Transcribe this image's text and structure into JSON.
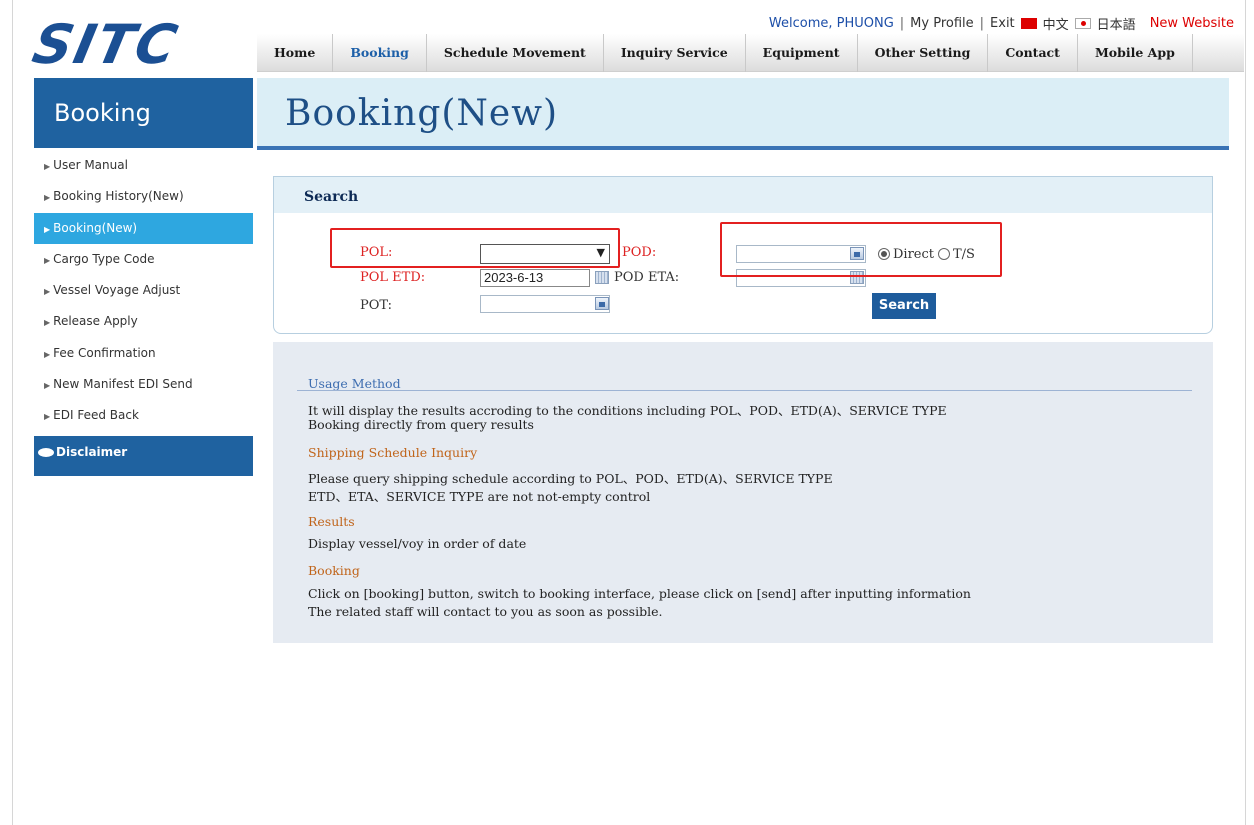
{
  "header": {
    "logo": "SITC",
    "welcome": "Welcome, PHUONG",
    "sep": "|",
    "my_profile": "My Profile",
    "exit": "Exit",
    "lang_cn": "中文",
    "lang_jp": "日本語",
    "new_website": "New Website"
  },
  "nav": [
    "Home",
    "Booking",
    "Schedule Movement",
    "Inquiry Service",
    "Equipment",
    "Other Setting",
    "Contact",
    "Mobile App"
  ],
  "sidebar": {
    "title": "Booking",
    "items": [
      "User Manual",
      "Booking History(New)",
      "Booking(New)",
      "Cargo Type Code",
      "Vessel Voyage Adjust",
      "Release Apply",
      "Fee Confirmation",
      "New Manifest EDI Send",
      "EDI Feed Back"
    ],
    "active_index": 2,
    "disclaimer": "Disclaimer"
  },
  "page": {
    "title": "Booking(New)"
  },
  "search": {
    "title": "Search",
    "pol_label": "POL:",
    "pol_value": "",
    "pod_label": "POD:",
    "pod_value": "",
    "pol_etd_label": "POL ETD:",
    "pol_etd_value": "2023-6-13",
    "pod_eta_label": "POD ETA:",
    "pod_eta_value": "",
    "pot_label": "POT:",
    "pot_value": "",
    "radio_direct": "Direct",
    "radio_ts": "T/S",
    "selected_route": "Direct",
    "button": "Search"
  },
  "usage": {
    "title": "Usage Method",
    "line1": "It will display the results accroding to the conditions including POL、POD、ETD(A)、SERVICE TYPE",
    "line2": "Booking directly from query results",
    "schedule_head": "Shipping Schedule Inquiry",
    "schedule_line1": "Please query shipping schedule according to POL、POD、ETD(A)、SERVICE TYPE",
    "schedule_line2": "ETD、ETA、SERVICE TYPE are not not-empty control",
    "results_head": "Results",
    "results_line": "Display vessel/voy in order of date",
    "booking_head": "Booking",
    "booking_line1": "Click on [booking] button, switch to booking interface, please click on [send] after inputting information",
    "booking_line2": "The related staff will contact to you as soon as possible."
  },
  "colors": {
    "brand_blue": "#1f62a0",
    "active_sidebar": "#2ea7e0",
    "highlight_red": "#e32020"
  }
}
